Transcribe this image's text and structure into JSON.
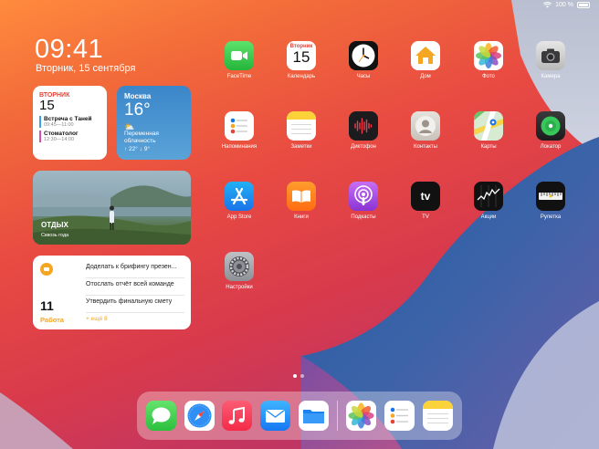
{
  "status": {
    "battery_text": "100 %"
  },
  "clock": {
    "time": "09:41",
    "date": "Вторник, 15 сентября"
  },
  "calendar_widget": {
    "weekday": "ВТОРНИК",
    "day": "15",
    "events": [
      {
        "title": "Встреча с Таней",
        "time": "09:45—11:00",
        "color": "#3aa0e8"
      },
      {
        "title": "Стоматолог",
        "time": "12:30—14:00",
        "color": "#d24fb5"
      }
    ]
  },
  "weather_widget": {
    "city": "Москва",
    "temp": "16°",
    "condition": "Переменная облачность",
    "range": "↑ 22° ↓ 9°"
  },
  "photo_widget": {
    "title": "ОТДЫХ",
    "subtitle": "Сквозь года"
  },
  "reminders_widget": {
    "count": "11",
    "list_name": "Работа",
    "items": [
      "Доделать к брифингу презен...",
      "Отослать отчёт всей команде",
      "Утвердить финальную смету"
    ],
    "more": "+ ещё 8",
    "accent": "#f5a623"
  },
  "apps": [
    {
      "label": "FaceTime",
      "icon": "facetime-icon"
    },
    {
      "label": "Календарь",
      "icon": "calendar-icon",
      "cal_weekday": "Вторник",
      "cal_day": "15"
    },
    {
      "label": "Часы",
      "icon": "clock-icon"
    },
    {
      "label": "Дом",
      "icon": "home-icon"
    },
    {
      "label": "Фото",
      "icon": "photos-icon"
    },
    {
      "label": "Камера",
      "icon": "camera-icon"
    },
    {
      "label": "Напоминания",
      "icon": "reminders-icon"
    },
    {
      "label": "Заметки",
      "icon": "notes-icon"
    },
    {
      "label": "Диктофон",
      "icon": "voice-memos-icon"
    },
    {
      "label": "Контакты",
      "icon": "contacts-icon"
    },
    {
      "label": "Карты",
      "icon": "maps-icon"
    },
    {
      "label": "Локатор",
      "icon": "find-my-icon"
    },
    {
      "label": "App Store",
      "icon": "app-store-icon"
    },
    {
      "label": "Книги",
      "icon": "books-icon"
    },
    {
      "label": "Подкасты",
      "icon": "podcasts-icon"
    },
    {
      "label": "TV",
      "icon": "tv-icon",
      "tv_text": "tv"
    },
    {
      "label": "Акции",
      "icon": "stocks-icon"
    },
    {
      "label": "Рулетка",
      "icon": "measure-icon"
    },
    {
      "label": "Настройки",
      "icon": "settings-icon"
    }
  ],
  "page_dots": {
    "count": 2,
    "active": 0
  },
  "dock": [
    {
      "name": "Messages",
      "icon": "messages-icon"
    },
    {
      "name": "Safari",
      "icon": "safari-icon"
    },
    {
      "name": "Music",
      "icon": "music-icon"
    },
    {
      "name": "Mail",
      "icon": "mail-icon"
    },
    {
      "name": "Files",
      "icon": "files-icon"
    },
    {
      "name": "Photos",
      "icon": "photos-icon"
    },
    {
      "name": "Reminders",
      "icon": "reminders-icon"
    },
    {
      "name": "Notes",
      "icon": "notes-icon"
    }
  ]
}
